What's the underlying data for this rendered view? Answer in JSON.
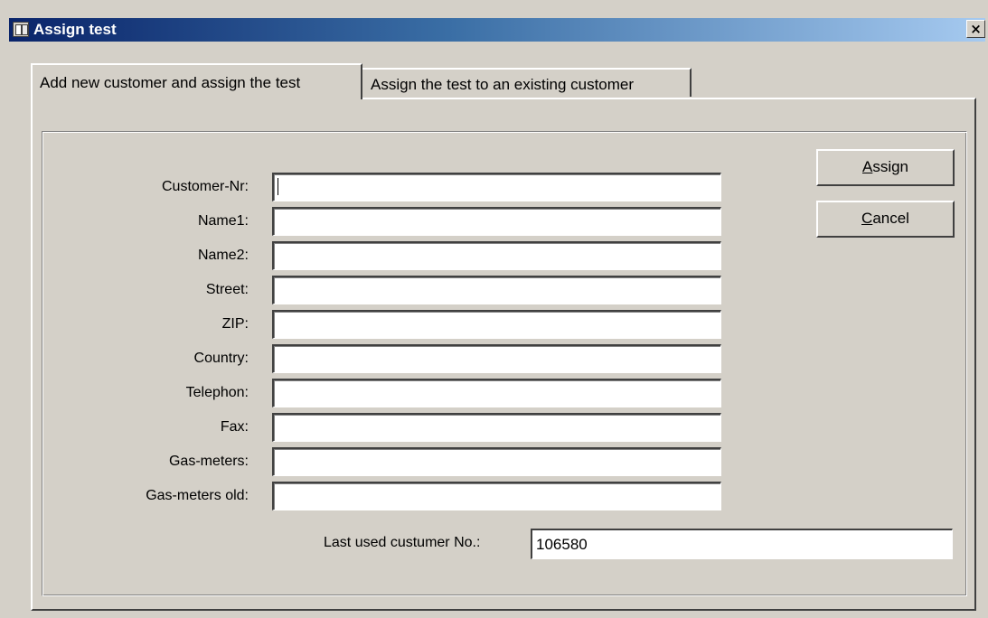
{
  "window": {
    "title": "Assign test",
    "close_label": "×"
  },
  "tabs": [
    {
      "label": "Add new customer and assign the test",
      "active": true
    },
    {
      "label": "Assign the test to an existing customer",
      "active": false
    }
  ],
  "form": {
    "fields": [
      {
        "label": "Customer-Nr:",
        "value": ""
      },
      {
        "label": "Name1:",
        "value": ""
      },
      {
        "label": "Name2:",
        "value": ""
      },
      {
        "label": "Street:",
        "value": ""
      },
      {
        "label": "ZIP:",
        "value": ""
      },
      {
        "label": "Country:",
        "value": ""
      },
      {
        "label": "Telephon:",
        "value": ""
      },
      {
        "label": "Fax:",
        "value": ""
      },
      {
        "label": "Gas-meters:",
        "value": ""
      },
      {
        "label": "Gas-meters old:",
        "value": ""
      }
    ],
    "last_used_label": "Last used custumer No.:",
    "last_used_value": "106580"
  },
  "buttons": {
    "assign_accel": "A",
    "assign_rest": "ssign",
    "cancel_accel": "C",
    "cancel_rest": "ancel"
  }
}
